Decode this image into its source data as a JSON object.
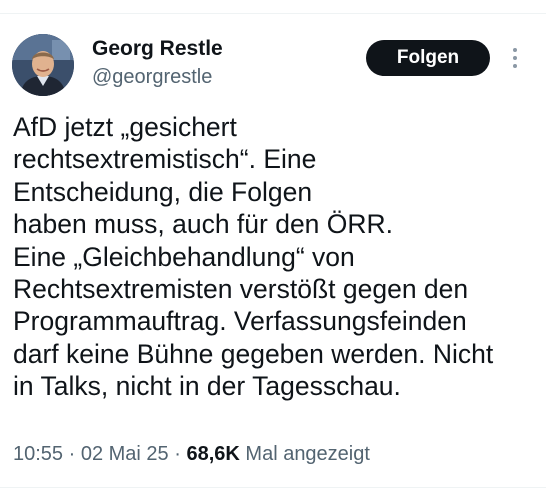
{
  "author": {
    "name": "Georg Restle",
    "handle": "@georgrestle"
  },
  "follow_button": {
    "label": "Folgen"
  },
  "more_icon": "more-vertical-icon",
  "tweet": {
    "lines": [
      "AfD jetzt „gesichert",
      "rechtsextremistisch“. Eine",
      "Entscheidung, die Folgen",
      "haben muss, auch für den ÖRR.",
      "Eine „Gleichbehandlung“ von",
      "Rechtsextremisten verstößt gegen den",
      "Programmauftrag. Verfassungsfeinden",
      "darf keine Bühne gegeben werden. Nicht",
      "in Talks, nicht in der Tagesschau."
    ]
  },
  "meta": {
    "time": "10:55",
    "separator": " · ",
    "date": "02 Mai 25",
    "views_count": "68,6K",
    "views_label": "Mal angezeigt"
  },
  "colors": {
    "text_primary": "#0f1419",
    "text_secondary": "#536471",
    "button_bg": "#0f1419",
    "button_text": "#ffffff"
  }
}
